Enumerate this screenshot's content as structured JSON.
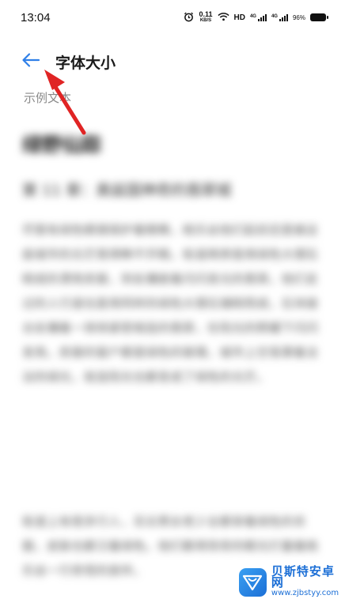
{
  "status_bar": {
    "time": "13:04",
    "net_speed_value": "0.11",
    "net_speed_unit": "KB/S",
    "hd_label": "HD",
    "sim1_tag": "4G",
    "sim2_tag": "4G",
    "battery_percent": "96%"
  },
  "header": {
    "title": "字体大小"
  },
  "sample": {
    "label": "示例文本",
    "book_title": "绿野仙踪",
    "chapter_title": "第 11 章：奥兹国神奇的翡翠城",
    "paragraph1": "尽管有绿色眼镜保护着眼睛，桃乐丝他们起初还是被这座城市的光芒晃得睁不开眼。街道两旁是用绿色大理石砌成的漂亮房屋，到处镶嵌着闪闪发光的翡翠。他们走过的人行道也是用同样的绿色大理石铺砌而成，石块接合处镶着一排排紧密相连的翡翠，在阳光的照耀下闪闪发亮。房屋的窗户都是绿色的玻璃，城市上空笼罩着淡淡的绿光，就连阳光也都变成了绿色的光芒。",
    "paragraph2": "街道上有很多行人，无论男女老少全都穿着绿色的衣服，皮肤也都泛着绿色。他们都用惊奇的眼光打量着桃乐丝一行奇怪的旅伴。"
  },
  "watermark": {
    "name": "贝斯特安卓网",
    "url": "www.zjbstyy.com"
  },
  "colors": {
    "accent_blue": "#2f7fe8",
    "annotation_red": "#e02424",
    "title_text": "#1a1a1a",
    "secondary_text": "#8a8a8a"
  }
}
